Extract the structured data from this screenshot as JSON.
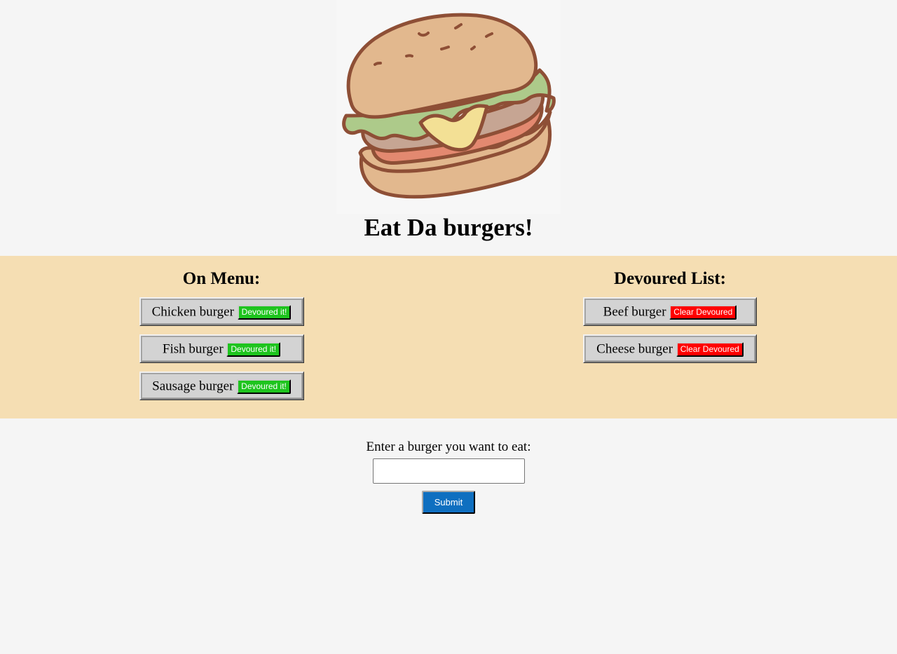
{
  "header": {
    "logo_icon": "burger-illustration",
    "title": "Eat Da burgers!"
  },
  "menu": {
    "heading": "On Menu:",
    "items": [
      {
        "name": "Chicken burger",
        "button_label": "Devoured it!"
      },
      {
        "name": "Fish burger",
        "button_label": "Devoured it!"
      },
      {
        "name": "Sausage burger",
        "button_label": "Devoured it!"
      }
    ]
  },
  "devoured": {
    "heading": "Devoured List:",
    "items": [
      {
        "name": "Beef burger",
        "button_label": "Clear Devoured"
      },
      {
        "name": "Cheese burger",
        "button_label": "Clear Devoured"
      }
    ]
  },
  "form": {
    "label": "Enter a burger you want to eat:",
    "input_value": "",
    "submit_label": "Submit"
  },
  "colors": {
    "page_background": "#f5f5f5",
    "band_background": "#f5deb3",
    "item_background": "#d3d3d3",
    "devour_button": "#1ec41e",
    "clear_button": "#ff0000",
    "submit_button": "#0f6fc0"
  }
}
